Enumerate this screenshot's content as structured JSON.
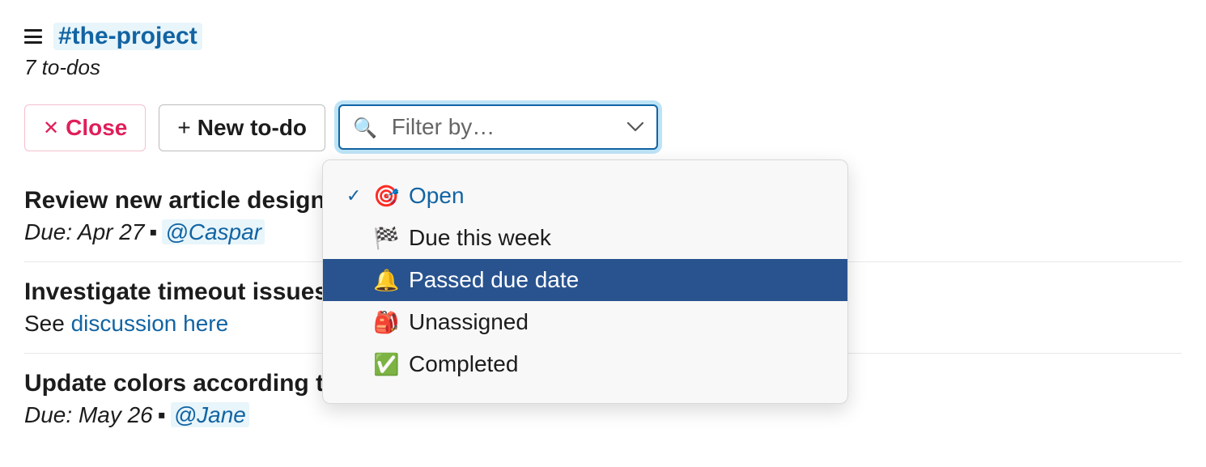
{
  "header": {
    "channel": "#the-project",
    "subhead": "7 to-dos"
  },
  "toolbar": {
    "close_label": "Close",
    "new_label": "New to-do",
    "filter_placeholder": "Filter by…"
  },
  "filter_options": [
    {
      "emoji": "🎯",
      "label": "Open",
      "selected": true,
      "highlight": false
    },
    {
      "emoji": "🏁",
      "label": "Due this week",
      "selected": false,
      "highlight": false
    },
    {
      "emoji": "🔔",
      "label": "Passed due date",
      "selected": false,
      "highlight": true
    },
    {
      "emoji": "🎒",
      "label": "Unassigned",
      "selected": false,
      "highlight": false
    },
    {
      "emoji": "✅",
      "label": "Completed",
      "selected": false,
      "highlight": false
    }
  ],
  "todos": [
    {
      "title": "Review new article design",
      "due_prefix": "Due: ",
      "due": "Apr 27",
      "assignee": "@Caspar",
      "desc_prefix": null,
      "desc_link": null
    },
    {
      "title": "Investigate timeout issues o",
      "due_prefix": null,
      "due": null,
      "assignee": null,
      "desc_prefix": "See ",
      "desc_link": "discussion here"
    },
    {
      "title": "Update colors according to new design system",
      "due_prefix": "Due: ",
      "due": "May 26",
      "assignee": "@Jane",
      "desc_prefix": null,
      "desc_link": null
    }
  ]
}
